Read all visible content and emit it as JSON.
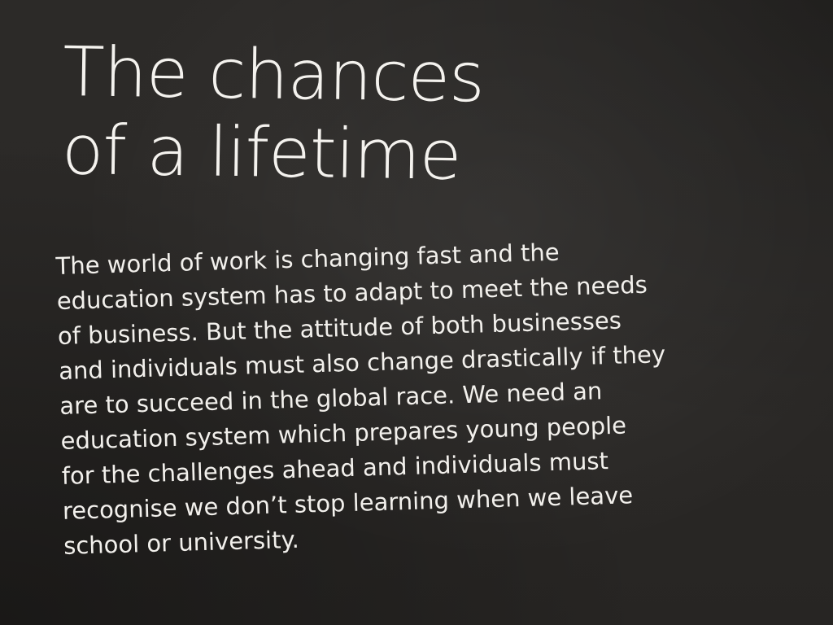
{
  "headline": {
    "line1": "The chances",
    "line2": "of a lifetime"
  },
  "body": {
    "lines": [
      "The world of work is changing fast and the",
      "education system has to adapt to meet the needs",
      "of business. But the attitude of both businesses",
      "and individuals must also change drastically if they",
      "are to succeed in the global race. We need an",
      "education system which prepares young people",
      "for the challenges ahead and individuals must",
      "recognise we don’t stop learning when we leave",
      "school or university."
    ]
  },
  "colors": {
    "background": "#2b2927",
    "text": "#f4f2ee"
  }
}
